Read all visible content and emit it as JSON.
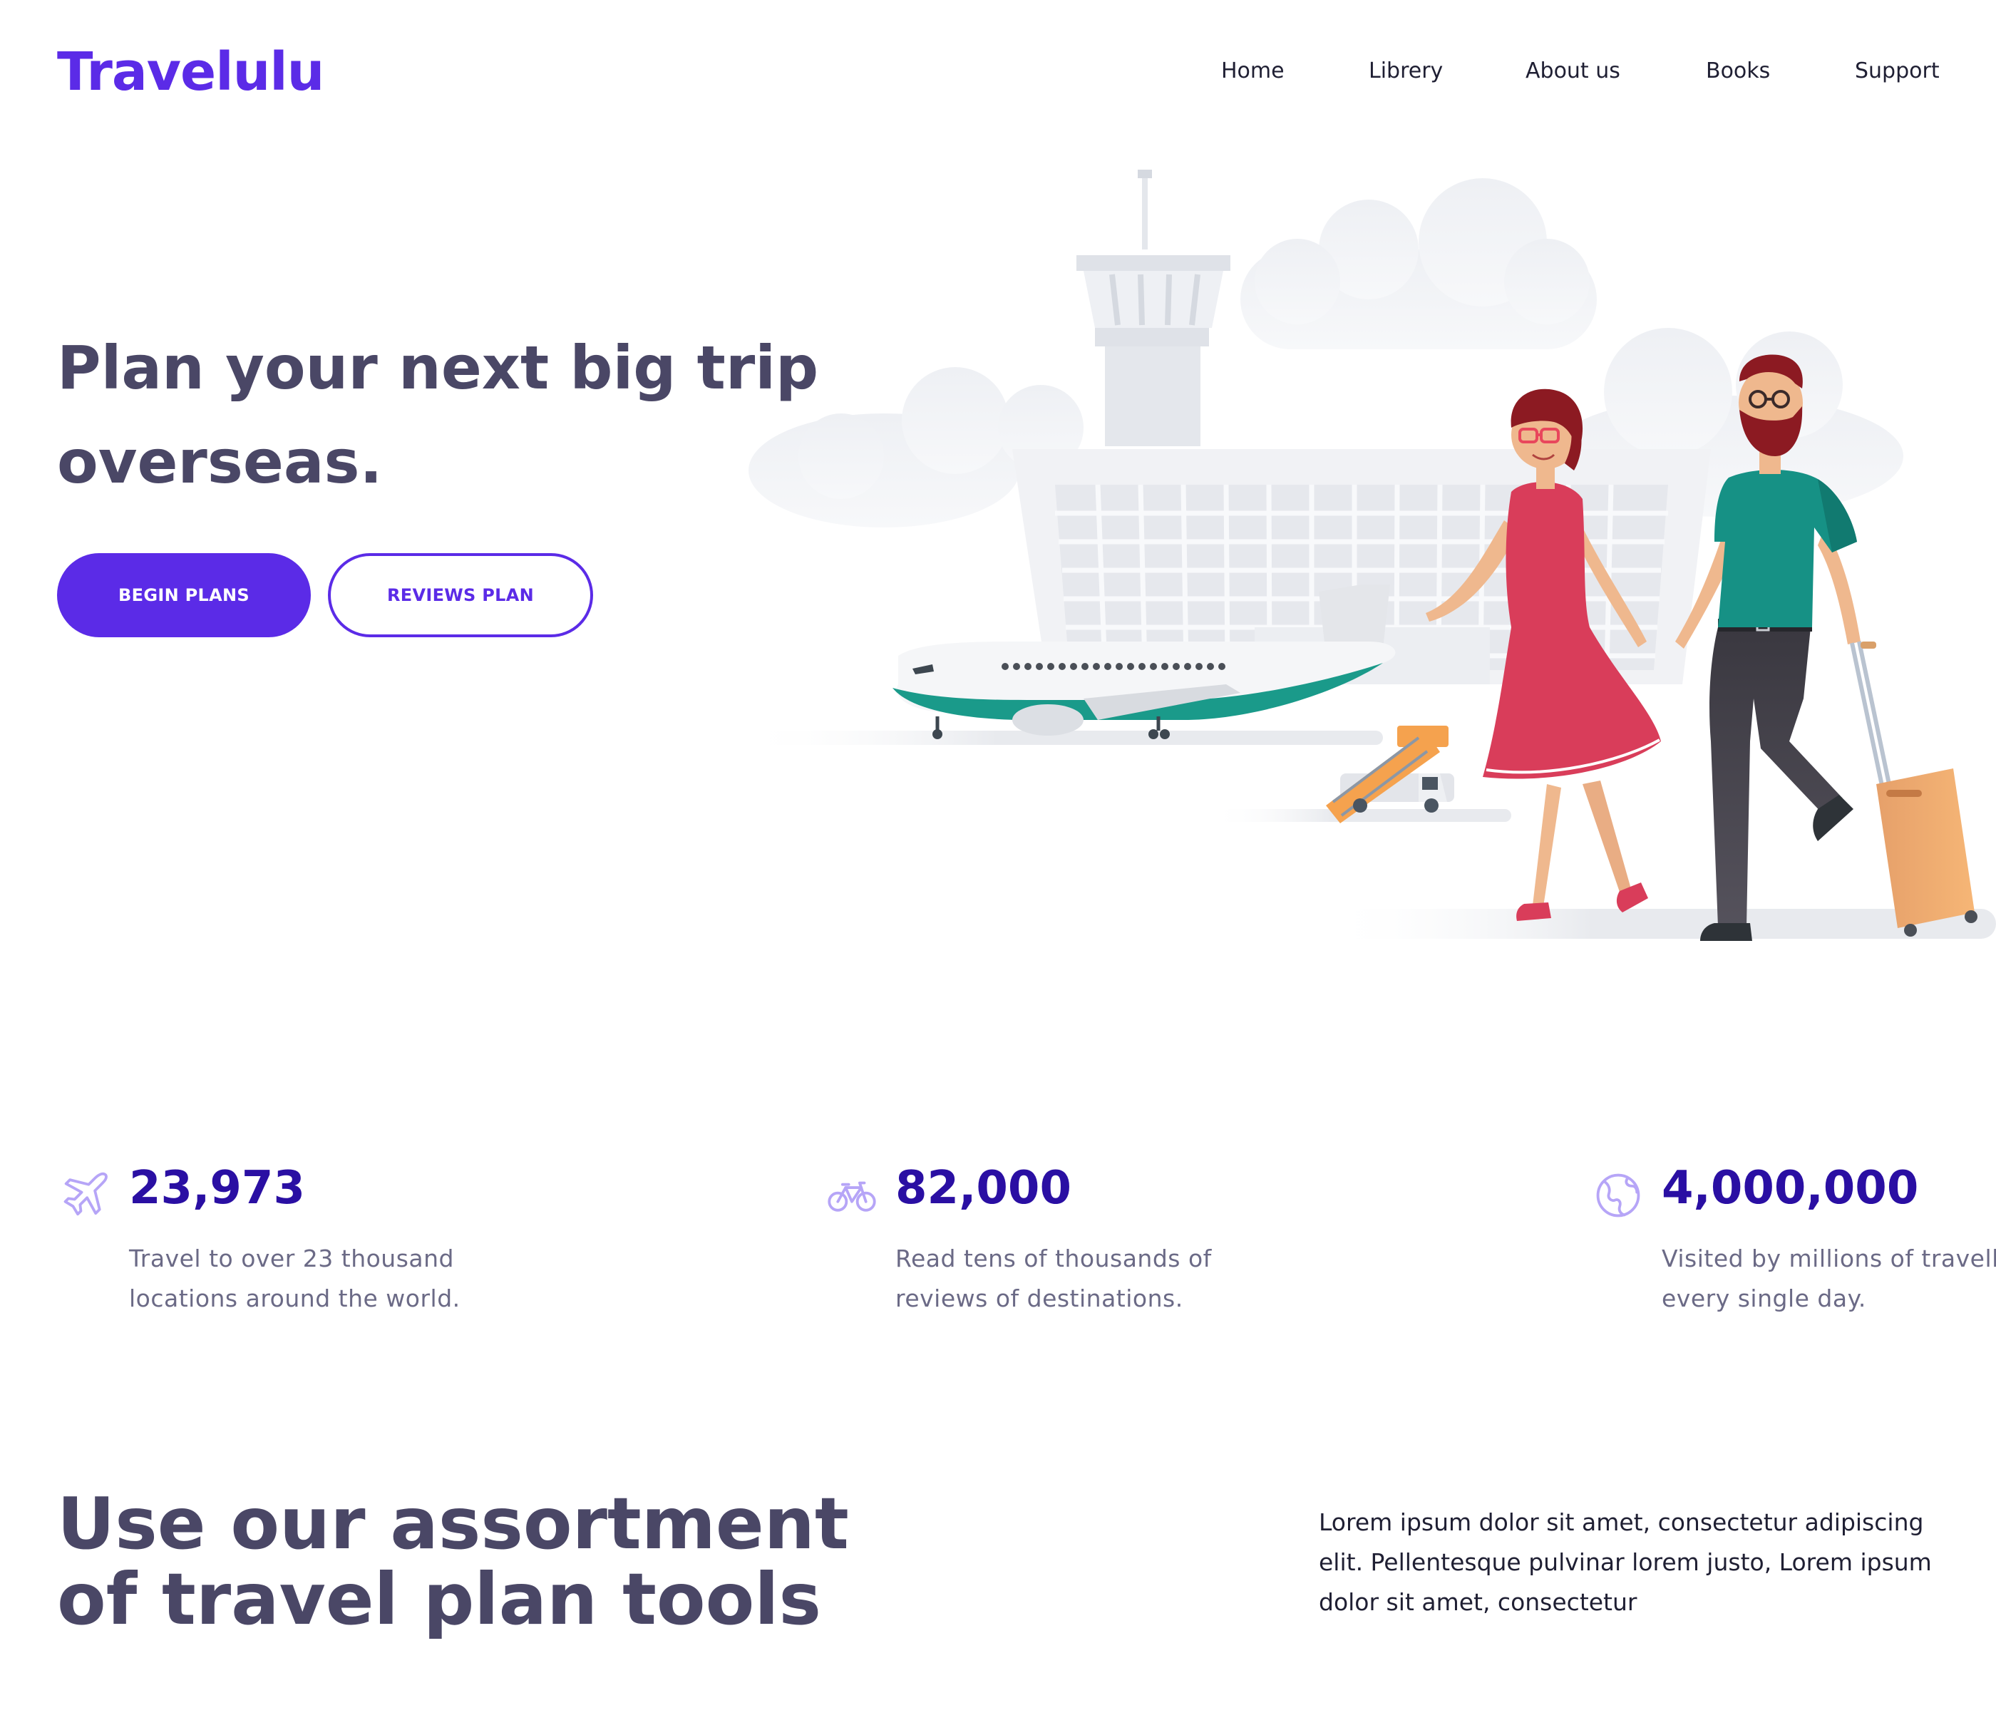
{
  "header": {
    "logo": "Travelulu",
    "nav": [
      {
        "label": "Home"
      },
      {
        "label": "Librery"
      },
      {
        "label": "About us"
      },
      {
        "label": "Books"
      },
      {
        "label": "Support"
      }
    ]
  },
  "hero": {
    "title": "Plan your next big trip overseas.",
    "primary_button": "BEGIN PLANS",
    "secondary_button": "REVIEWS PLAN"
  },
  "stats": [
    {
      "icon": "airplane-icon",
      "number": "23,973",
      "description": "Travel to over 23 thousand locations around the world."
    },
    {
      "icon": "bicycle-icon",
      "number": "82,000",
      "description": "Read tens of thousands of reviews of destinations."
    },
    {
      "icon": "globe-icon",
      "number": "4,000,000",
      "description": "Visited by millions of travellers every single day."
    }
  ],
  "tools": {
    "title": "Use our assortment of travel plan tools",
    "text": "Lorem ipsum dolor sit amet, consectetur adipiscing elit. Pellentesque pulvinar lorem justo, Lorem ipsum dolor sit amet, consectetur"
  },
  "colors": {
    "brand": "#5b2be7",
    "heading": "#4a4766",
    "stat_number": "#2a0fa3",
    "body_text": "#6b6a86",
    "icon": "#b6a5f7"
  }
}
